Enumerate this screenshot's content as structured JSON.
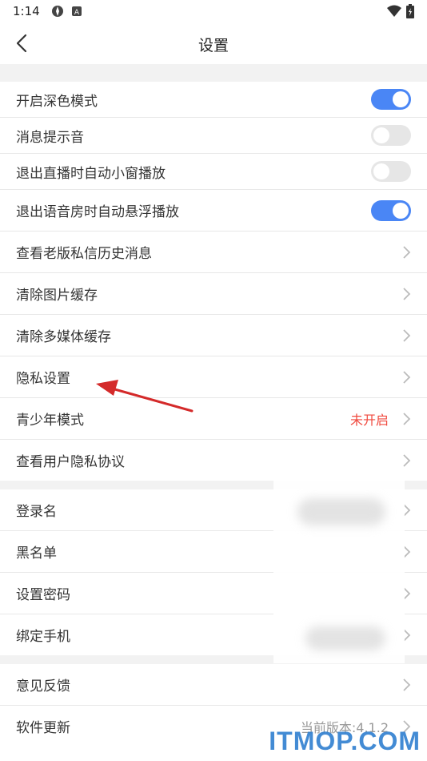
{
  "statusbar": {
    "time": "1:14"
  },
  "header": {
    "title": "设置"
  },
  "sections": [
    {
      "rows": [
        {
          "label": "开启深色模式",
          "kind": "toggle",
          "on": true
        },
        {
          "label": "消息提示音",
          "kind": "toggle",
          "on": false
        },
        {
          "label": "退出直播时自动小窗播放",
          "kind": "toggle",
          "on": false
        },
        {
          "label": "退出语音房时自动悬浮播放",
          "kind": "toggle",
          "on": true
        },
        {
          "label": "查看老版私信历史消息",
          "kind": "nav"
        },
        {
          "label": "清除图片缓存",
          "kind": "nav"
        },
        {
          "label": "清除多媒体缓存",
          "kind": "nav"
        },
        {
          "label": "隐私设置",
          "kind": "nav"
        },
        {
          "label": "青少年模式",
          "kind": "nav",
          "value": "未开启"
        },
        {
          "label": "查看用户隐私协议",
          "kind": "nav"
        }
      ]
    },
    {
      "rows": [
        {
          "label": "登录名",
          "kind": "nav"
        },
        {
          "label": "黑名单",
          "kind": "nav"
        },
        {
          "label": "设置密码",
          "kind": "nav"
        },
        {
          "label": "绑定手机",
          "kind": "nav"
        }
      ]
    },
    {
      "rows": [
        {
          "label": "意见反馈",
          "kind": "nav"
        },
        {
          "label": "软件更新",
          "kind": "nav",
          "value": "当前版本:4.1.2"
        }
      ]
    }
  ],
  "watermark": "ITMOP.COM",
  "colors": {
    "toggle_on": "#4a86f5",
    "toggle_off": "#e6e6e6",
    "value_red": "#f04a3f",
    "arrow": "#d42a2a",
    "watermark": "#2f7fd0"
  }
}
